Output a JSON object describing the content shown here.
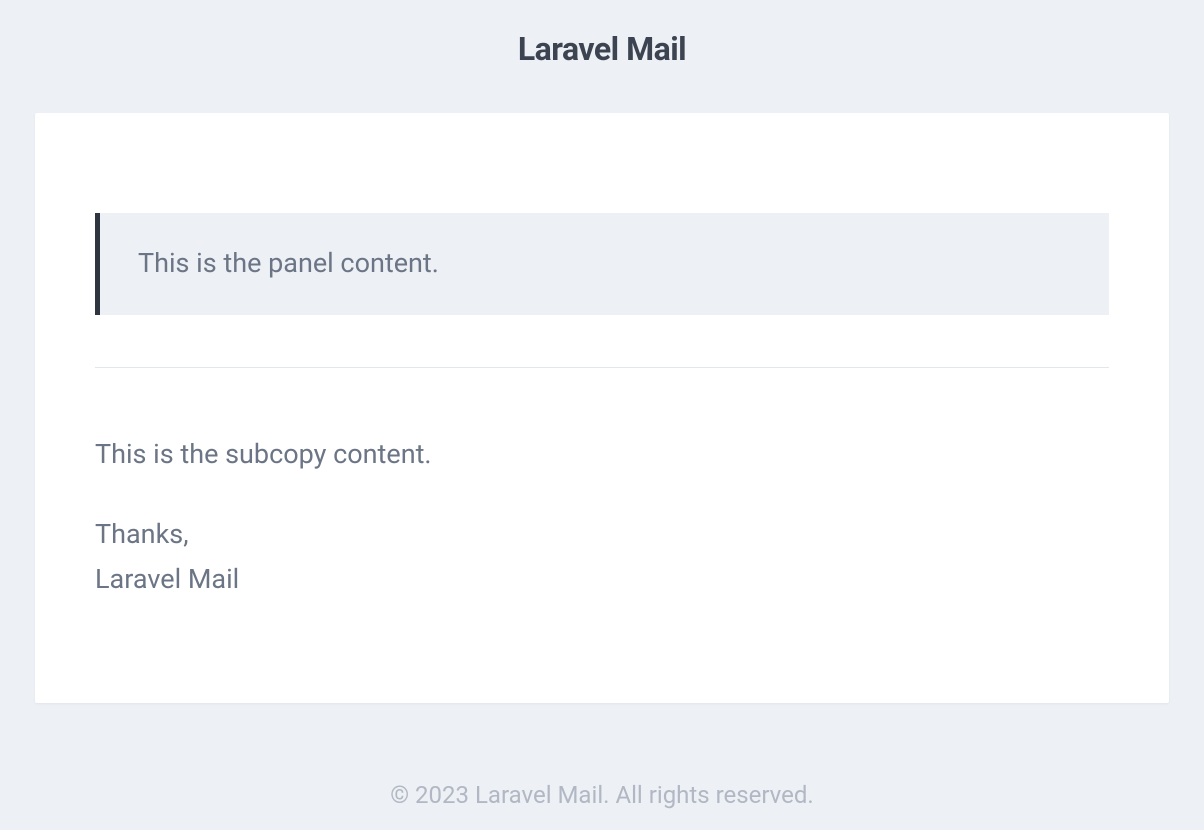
{
  "header": {
    "title": "Laravel Mail"
  },
  "body": {
    "panel": {
      "content": "This is the panel content."
    },
    "subcopy": "This is the subcopy content.",
    "signoff": {
      "closing": "Thanks,",
      "sender": "Laravel Mail"
    }
  },
  "footer": {
    "copyright": "© 2023 Laravel Mail. All rights reserved."
  }
}
